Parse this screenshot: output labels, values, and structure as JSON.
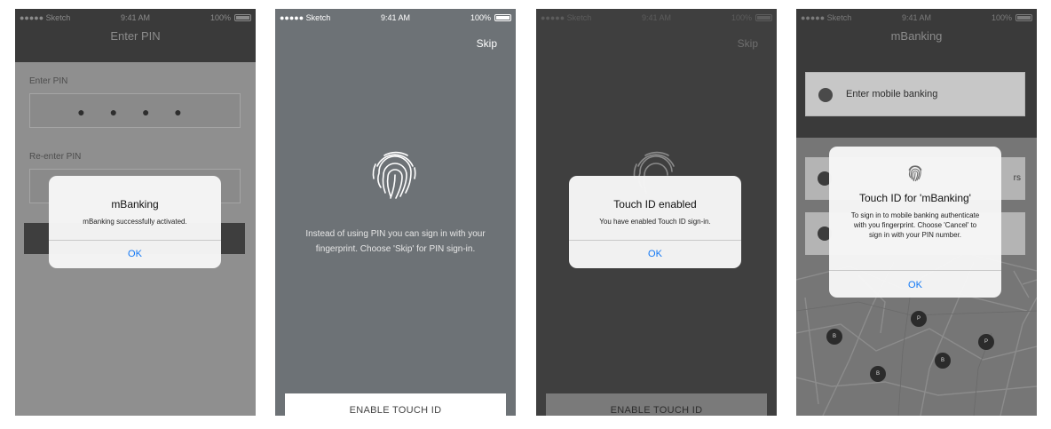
{
  "status_bar": {
    "carrier": "●●●●● Sketch",
    "time": "9:41 AM",
    "battery": "100%"
  },
  "screen1": {
    "title": "Enter PIN",
    "enter_pin_label": "Enter PIN",
    "pin_masked": "● ● ● ●",
    "reenter_pin_label": "Re-enter PIN",
    "alert": {
      "title": "mBanking",
      "message": "mBanking successfully activated.",
      "ok": "OK"
    }
  },
  "screen2": {
    "skip": "Skip",
    "explanation": "Instead of using PIN you can sign in with your fingerprint. Choose 'Skip' for PIN sign-in.",
    "button": "ENABLE TOUCH ID"
  },
  "screen3": {
    "skip": "Skip",
    "alert": {
      "title": "Touch ID enabled",
      "message": "You have enabled Touch ID sign-in.",
      "ok": "OK"
    },
    "button": "ENABLE TOUCH ID"
  },
  "screen4": {
    "title": "mBanking",
    "field": "Enter mobile banking",
    "row1_tail": "rs",
    "alert": {
      "title": "Touch ID for 'mBanking'",
      "message": "To sign in to mobile banking authenticate with you fingerprint. Choose 'Cancel' to sign in with your PIN number.",
      "ok": "OK"
    },
    "markers": [
      "B",
      "P",
      "P",
      "B",
      "B"
    ]
  },
  "colors": {
    "ios_blue": "#1278f5",
    "nav_dark": "#3a3a3a"
  }
}
